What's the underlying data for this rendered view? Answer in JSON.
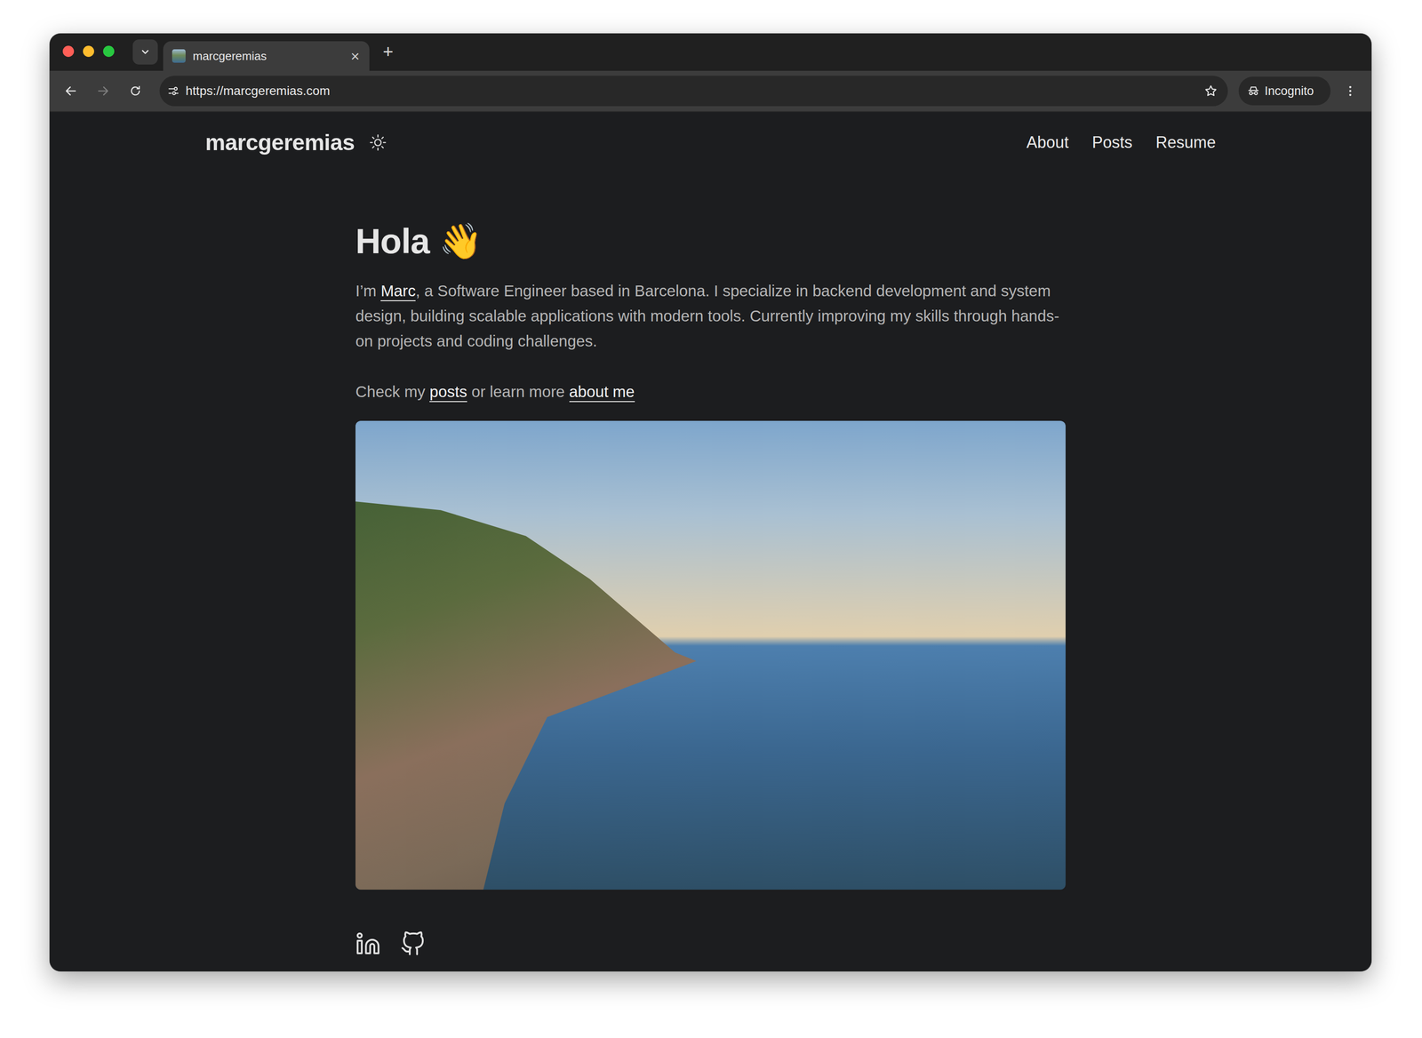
{
  "tabs": [
    {
      "label": "marcgeremias",
      "selected": true,
      "close": "×"
    }
  ],
  "new_tab": "+",
  "nav_buttons": [
    {
      "kind": "back",
      "disabled": false
    },
    {
      "kind": "forward",
      "disabled": true
    },
    {
      "kind": "reload",
      "disabled": false
    }
  ],
  "address_bar": {
    "url": "https://marcgeremias.com",
    "bookmarked": false
  },
  "profile": {
    "label": "Incognito"
  },
  "site": {
    "logo": "marcgeremias",
    "nav": [
      {
        "label": "About"
      },
      {
        "label": "Posts"
      },
      {
        "label": "Resume"
      }
    ]
  },
  "hero": {
    "heading": "Hola",
    "emoji": "👋",
    "intro": [
      {
        "text": "I’m ",
        "link": false
      },
      {
        "text": "Marc",
        "link": true
      },
      {
        "text": ", a Software Engineer based in Barcelona. I specialize in backend development and system design, building scalable applications with modern tools. Currently improving my skills through hands-on projects and coding challenges.",
        "link": false
      }
    ],
    "cta": [
      {
        "text": "Check my ",
        "link": false
      },
      {
        "text": "posts",
        "link": true
      },
      {
        "text": " or learn more ",
        "link": false
      },
      {
        "text": "about me",
        "link": true
      }
    ]
  },
  "social": [
    {
      "kind": "linkedin"
    },
    {
      "kind": "github"
    }
  ]
}
